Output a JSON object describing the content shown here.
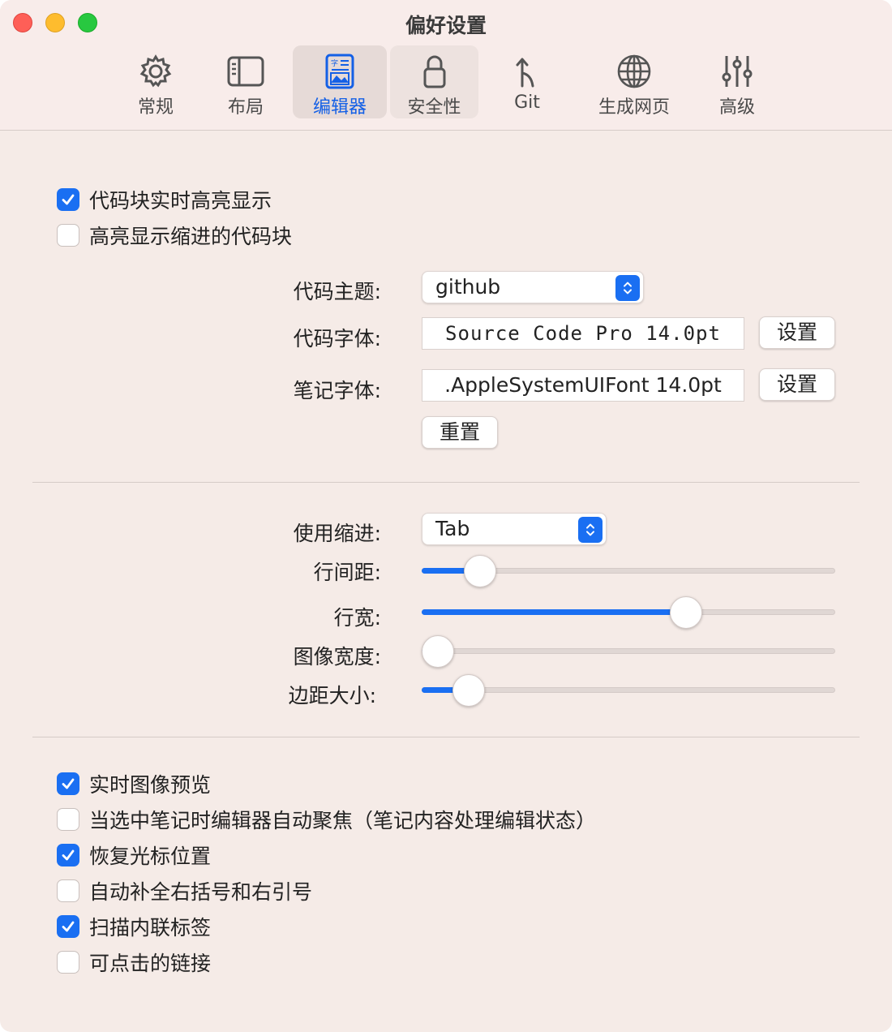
{
  "window": {
    "title": "偏好设置"
  },
  "toolbar": {
    "tabs": [
      {
        "label": "常规",
        "icon": "gear-icon"
      },
      {
        "label": "布局",
        "icon": "sidebar-layout-icon"
      },
      {
        "label": "编辑器",
        "icon": "editor-icon",
        "selected": true
      },
      {
        "label": "安全性",
        "icon": "lock-icon"
      },
      {
        "label": "Git",
        "icon": "git-branch-icon"
      },
      {
        "label": "生成网页",
        "icon": "globe-icon"
      },
      {
        "label": "高级",
        "icon": "sliders-icon"
      }
    ]
  },
  "highlight": {
    "items": [
      {
        "label": "代码块实时高亮显示",
        "checked": true
      },
      {
        "label": "高亮显示缩进的代码块",
        "checked": false
      }
    ]
  },
  "fonts": {
    "code_theme_label": "代码主题:",
    "code_theme_value": "github",
    "code_font_label": "代码字体:",
    "code_font_value": "Source Code Pro 14.0pt",
    "note_font_label": "笔记字体:",
    "note_font_value": ".AppleSystemUIFont 14.0pt",
    "set_button": "设置",
    "reset_button": "重置"
  },
  "layout": {
    "indent_label": "使用缩进:",
    "indent_value": "Tab",
    "sliders": [
      {
        "label": "行间距:",
        "value": 0.11
      },
      {
        "label": "行宽:",
        "value": 0.65
      },
      {
        "label": "图像宽度:",
        "value": 0.0
      },
      {
        "label": "边距大小:",
        "value": 0.08
      }
    ]
  },
  "options": {
    "items": [
      {
        "label": "实时图像预览",
        "checked": true
      },
      {
        "label": "当选中笔记时编辑器自动聚焦（笔记内容处理编辑状态）",
        "checked": false
      },
      {
        "label": "恢复光标位置",
        "checked": true
      },
      {
        "label": "自动补全右括号和右引号",
        "checked": false
      },
      {
        "label": "扫描内联标签",
        "checked": true
      },
      {
        "label": "可点击的链接",
        "checked": false
      }
    ]
  },
  "colors": {
    "accent": "#1a6ff2",
    "background": "#f5ebe7"
  }
}
